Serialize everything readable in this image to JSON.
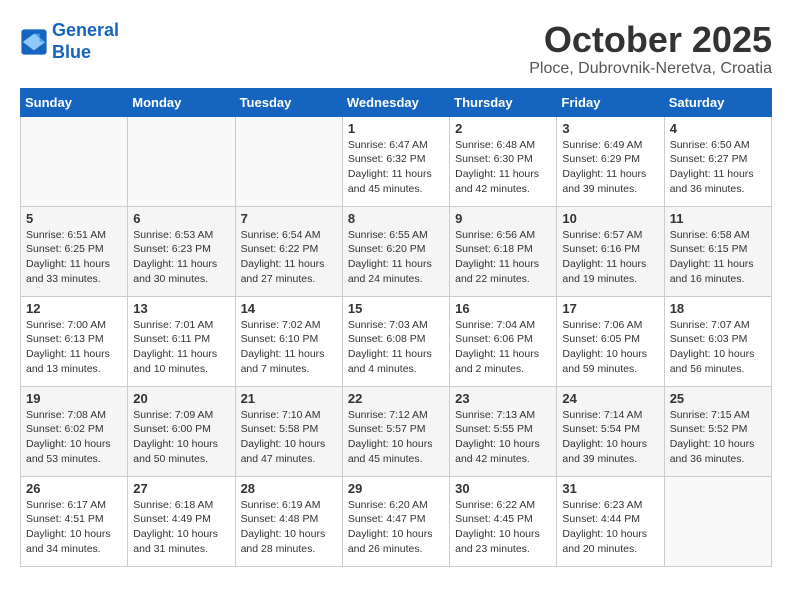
{
  "logo": {
    "line1": "General",
    "line2": "Blue"
  },
  "title": "October 2025",
  "subtitle": "Ploce, Dubrovnik-Neretva, Croatia",
  "days_of_week": [
    "Sunday",
    "Monday",
    "Tuesday",
    "Wednesday",
    "Thursday",
    "Friday",
    "Saturday"
  ],
  "weeks": [
    [
      {
        "day": "",
        "info": ""
      },
      {
        "day": "",
        "info": ""
      },
      {
        "day": "",
        "info": ""
      },
      {
        "day": "1",
        "info": "Sunrise: 6:47 AM\nSunset: 6:32 PM\nDaylight: 11 hours and 45 minutes."
      },
      {
        "day": "2",
        "info": "Sunrise: 6:48 AM\nSunset: 6:30 PM\nDaylight: 11 hours and 42 minutes."
      },
      {
        "day": "3",
        "info": "Sunrise: 6:49 AM\nSunset: 6:29 PM\nDaylight: 11 hours and 39 minutes."
      },
      {
        "day": "4",
        "info": "Sunrise: 6:50 AM\nSunset: 6:27 PM\nDaylight: 11 hours and 36 minutes."
      }
    ],
    [
      {
        "day": "5",
        "info": "Sunrise: 6:51 AM\nSunset: 6:25 PM\nDaylight: 11 hours and 33 minutes."
      },
      {
        "day": "6",
        "info": "Sunrise: 6:53 AM\nSunset: 6:23 PM\nDaylight: 11 hours and 30 minutes."
      },
      {
        "day": "7",
        "info": "Sunrise: 6:54 AM\nSunset: 6:22 PM\nDaylight: 11 hours and 27 minutes."
      },
      {
        "day": "8",
        "info": "Sunrise: 6:55 AM\nSunset: 6:20 PM\nDaylight: 11 hours and 24 minutes."
      },
      {
        "day": "9",
        "info": "Sunrise: 6:56 AM\nSunset: 6:18 PM\nDaylight: 11 hours and 22 minutes."
      },
      {
        "day": "10",
        "info": "Sunrise: 6:57 AM\nSunset: 6:16 PM\nDaylight: 11 hours and 19 minutes."
      },
      {
        "day": "11",
        "info": "Sunrise: 6:58 AM\nSunset: 6:15 PM\nDaylight: 11 hours and 16 minutes."
      }
    ],
    [
      {
        "day": "12",
        "info": "Sunrise: 7:00 AM\nSunset: 6:13 PM\nDaylight: 11 hours and 13 minutes."
      },
      {
        "day": "13",
        "info": "Sunrise: 7:01 AM\nSunset: 6:11 PM\nDaylight: 11 hours and 10 minutes."
      },
      {
        "day": "14",
        "info": "Sunrise: 7:02 AM\nSunset: 6:10 PM\nDaylight: 11 hours and 7 minutes."
      },
      {
        "day": "15",
        "info": "Sunrise: 7:03 AM\nSunset: 6:08 PM\nDaylight: 11 hours and 4 minutes."
      },
      {
        "day": "16",
        "info": "Sunrise: 7:04 AM\nSunset: 6:06 PM\nDaylight: 11 hours and 2 minutes."
      },
      {
        "day": "17",
        "info": "Sunrise: 7:06 AM\nSunset: 6:05 PM\nDaylight: 10 hours and 59 minutes."
      },
      {
        "day": "18",
        "info": "Sunrise: 7:07 AM\nSunset: 6:03 PM\nDaylight: 10 hours and 56 minutes."
      }
    ],
    [
      {
        "day": "19",
        "info": "Sunrise: 7:08 AM\nSunset: 6:02 PM\nDaylight: 10 hours and 53 minutes."
      },
      {
        "day": "20",
        "info": "Sunrise: 7:09 AM\nSunset: 6:00 PM\nDaylight: 10 hours and 50 minutes."
      },
      {
        "day": "21",
        "info": "Sunrise: 7:10 AM\nSunset: 5:58 PM\nDaylight: 10 hours and 47 minutes."
      },
      {
        "day": "22",
        "info": "Sunrise: 7:12 AM\nSunset: 5:57 PM\nDaylight: 10 hours and 45 minutes."
      },
      {
        "day": "23",
        "info": "Sunrise: 7:13 AM\nSunset: 5:55 PM\nDaylight: 10 hours and 42 minutes."
      },
      {
        "day": "24",
        "info": "Sunrise: 7:14 AM\nSunset: 5:54 PM\nDaylight: 10 hours and 39 minutes."
      },
      {
        "day": "25",
        "info": "Sunrise: 7:15 AM\nSunset: 5:52 PM\nDaylight: 10 hours and 36 minutes."
      }
    ],
    [
      {
        "day": "26",
        "info": "Sunrise: 6:17 AM\nSunset: 4:51 PM\nDaylight: 10 hours and 34 minutes."
      },
      {
        "day": "27",
        "info": "Sunrise: 6:18 AM\nSunset: 4:49 PM\nDaylight: 10 hours and 31 minutes."
      },
      {
        "day": "28",
        "info": "Sunrise: 6:19 AM\nSunset: 4:48 PM\nDaylight: 10 hours and 28 minutes."
      },
      {
        "day": "29",
        "info": "Sunrise: 6:20 AM\nSunset: 4:47 PM\nDaylight: 10 hours and 26 minutes."
      },
      {
        "day": "30",
        "info": "Sunrise: 6:22 AM\nSunset: 4:45 PM\nDaylight: 10 hours and 23 minutes."
      },
      {
        "day": "31",
        "info": "Sunrise: 6:23 AM\nSunset: 4:44 PM\nDaylight: 10 hours and 20 minutes."
      },
      {
        "day": "",
        "info": ""
      }
    ]
  ]
}
